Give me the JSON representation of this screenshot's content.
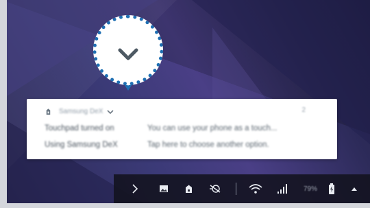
{
  "notification": {
    "app_name": "Samsung DeX",
    "count": "2",
    "rows": [
      {
        "title": "Touchpad turned on",
        "text": "You can use your phone as a touch..."
      },
      {
        "title": "Using Samsung DeX",
        "text": "Tap here to choose another option."
      }
    ]
  },
  "callout": {
    "icon": "chevron-down-icon",
    "color": "#1e6fb3"
  },
  "taskbar": {
    "items": [
      "expand-arrow-icon",
      "gallery-icon",
      "notification-app-icon",
      "no-sync-icon",
      "wifi-icon",
      "signal-icon",
      "battery-icon",
      "up-caret-icon"
    ],
    "battery_percent": "79%"
  }
}
